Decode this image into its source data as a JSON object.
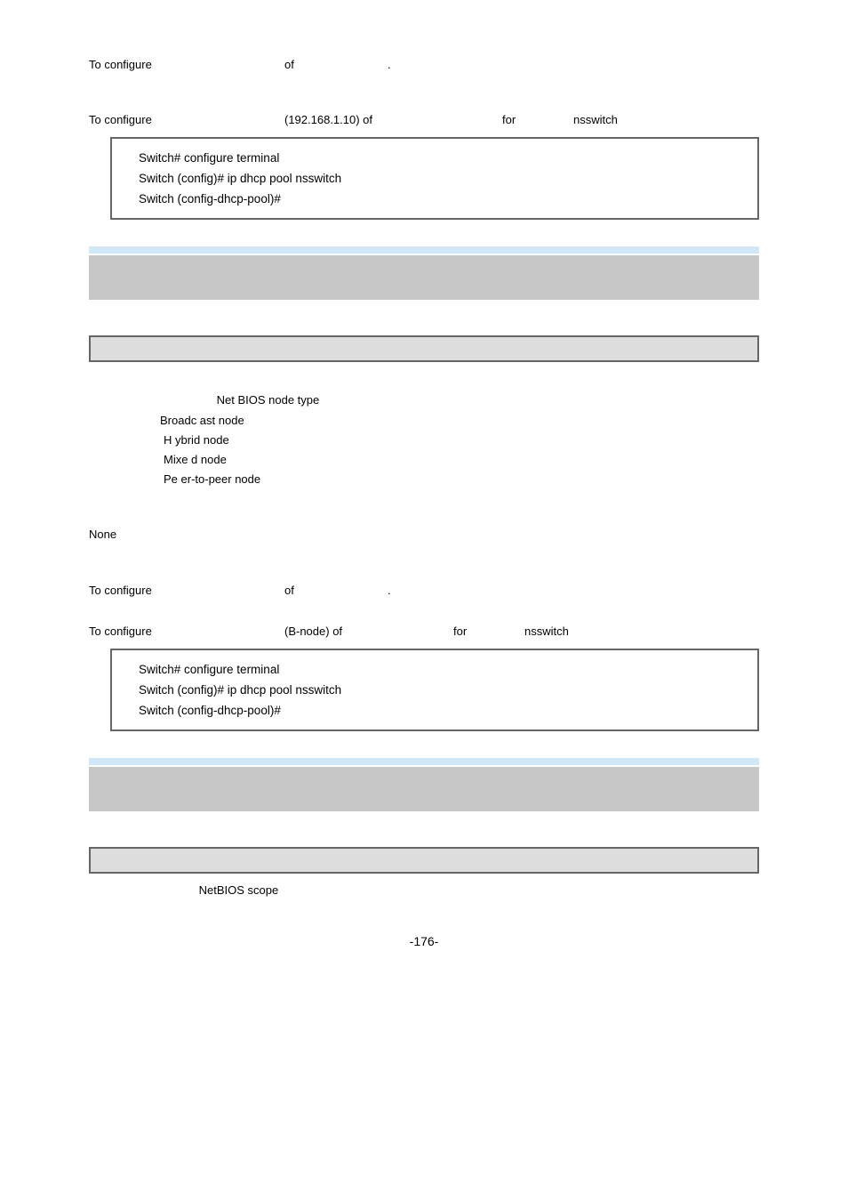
{
  "line1": {
    "a": "To configure",
    "b": "of",
    "c": "."
  },
  "line2": {
    "a": "To configure",
    "b": "(192.168.1.10) of",
    "c": "for",
    "d": "nsswitch"
  },
  "code1": {
    "l1": "Switch# configure terminal",
    "l2": "Switch (config)# ip dhcp pool nsswitch",
    "l3": "Switch (config-dhcp-pool)#"
  },
  "nodetype_label": "Net  BIOS node type",
  "node_b": "Broadc  ast node",
  "node_h": "H ybrid node",
  "node_m": "Mixe  d node",
  "node_p": "Pe er-to-peer node",
  "none": "None",
  "line3": {
    "a": "To configure",
    "b": "of",
    "c": "."
  },
  "line4": {
    "a": "To configure",
    "b": "(B-node) of",
    "c": "for",
    "d": "nsswitch"
  },
  "code2": {
    "l1": "Switch# configure terminal",
    "l2": "Switch (config)# ip dhcp pool nsswitch",
    "l3": "Switch (config-dhcp-pool)#"
  },
  "scope_label": "NetBIOS scope",
  "page_num": "-176-"
}
